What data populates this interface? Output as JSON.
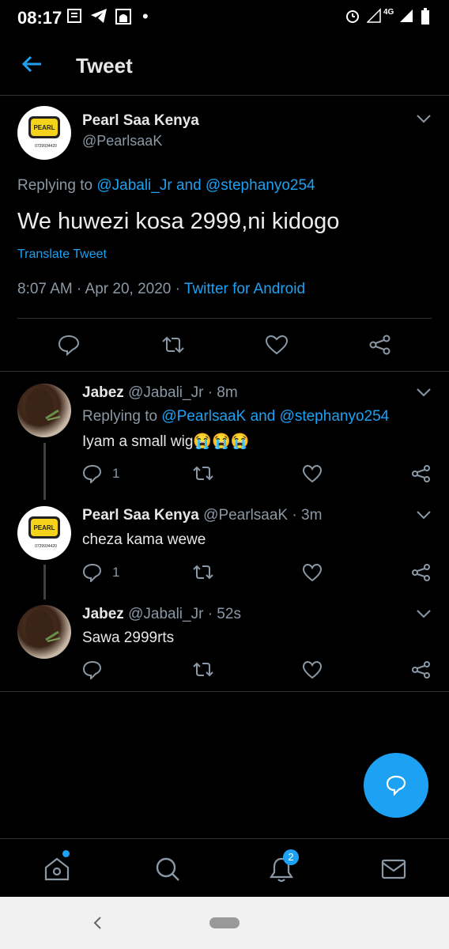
{
  "status_bar": {
    "time": "08:17",
    "network": "4G"
  },
  "header": {
    "title": "Tweet"
  },
  "main_tweet": {
    "author_name": "Pearl Saa Kenya",
    "handle": "@PearlsaaK",
    "replying_prefix": "Replying to",
    "replying_users": "@Jabali_Jr and @stephanyo254",
    "text": "We huwezi kosa 2999,ni kidogo",
    "translate": "Translate Tweet",
    "timestamp": "8:07 AM · Apr 20, 2020 ·",
    "source": "Twitter for Android",
    "avatar_text": "PEARL",
    "avatar_phone": "0729934420"
  },
  "replies": [
    {
      "author_name": "Jabez",
      "handle": "@Jabali_Jr",
      "age": "· 8m",
      "replying_prefix": "Replying to",
      "replying_users": "@PearlsaaK and @stephanyo254",
      "text": "Iyam a small wig😭😭😭",
      "reply_count": "1"
    },
    {
      "author_name": "Pearl Saa Kenya",
      "handle": "@PearlsaaK",
      "age": "· 3m",
      "text": "cheza kama wewe",
      "reply_count": "1"
    },
    {
      "author_name": "Jabez",
      "handle": "@Jabali_Jr",
      "age": "· 52s",
      "text": "Sawa 2999rts",
      "reply_count": ""
    }
  ],
  "bottom_nav": {
    "notifications_badge": "2"
  },
  "colors": {
    "accent": "#1da1f2",
    "background": "#000000",
    "muted": "#8b98a5"
  }
}
